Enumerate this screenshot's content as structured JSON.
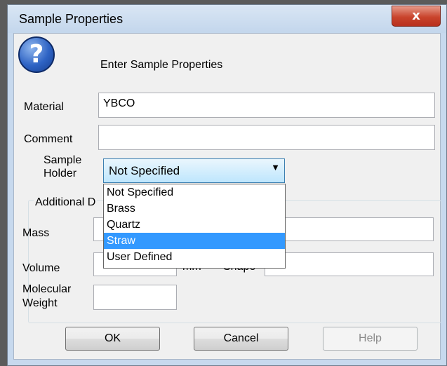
{
  "window": {
    "title": "Sample Properties",
    "close_label": "x"
  },
  "dialog": {
    "icon": "question-icon",
    "heading": "Enter Sample Properties"
  },
  "fields": {
    "material_label": "Material",
    "material_value": "YBCO",
    "comment_label": "Comment",
    "comment_value": "",
    "holder_label_line1": "Sample",
    "holder_label_line2": "Holder",
    "holder_selected": "Not Specified",
    "holder_options": [
      "Not Specified",
      "Brass",
      "Quartz",
      "Straw",
      "User Defined"
    ],
    "holder_highlighted": "Straw"
  },
  "additional": {
    "group_title": "Additional D",
    "mass_label": "Mass",
    "volume_label": "Volume",
    "volume_unit": "mm",
    "shape_label": "Shape",
    "molecular_label_line1": "Molecular",
    "molecular_label_line2": "Weight"
  },
  "buttons": {
    "ok": "OK",
    "cancel": "Cancel",
    "help": "Help"
  }
}
